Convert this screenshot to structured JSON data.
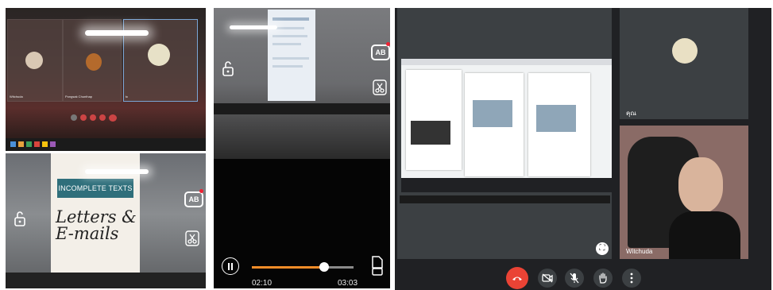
{
  "photo_meeting": {
    "tile_names": [
      "Witchuda",
      "Pongsak Chunthap",
      "tc"
    ]
  },
  "photo_slide": {
    "banner": "INCOMPLETE TEXTS",
    "handwritten": "Letters & E-mails",
    "overlay_ab": "AB"
  },
  "video_player": {
    "elapsed": "02:10",
    "duration": "03:03",
    "progress": 0.71,
    "overlay_ab": "AB"
  },
  "meet": {
    "tile_a_name": "คุณ",
    "tile_b_name": "Witchuda",
    "colors": {
      "end_call": "#ea4335",
      "accent": "#f28c28"
    }
  }
}
